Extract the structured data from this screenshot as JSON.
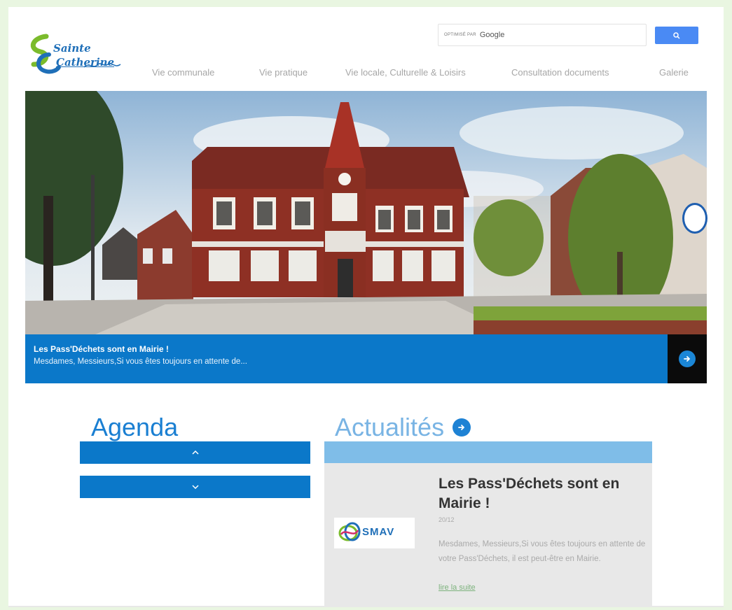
{
  "header": {
    "logo_line1": "Sainte",
    "logo_line2": "Catherine",
    "search": {
      "powered_by": "OPTIMISÉ PAR",
      "brand": "Google",
      "placeholder": ""
    }
  },
  "nav": {
    "items": [
      {
        "label": "Vie communale"
      },
      {
        "label": "Vie pratique"
      },
      {
        "label": "Vie locale, Culturelle & Loisirs"
      },
      {
        "label": "Consultation documents"
      },
      {
        "label": "Galerie"
      }
    ]
  },
  "hero": {
    "caption_title": "Les Pass'Déchets sont en Mairie !",
    "caption_text": "Mesdames, Messieurs,Si vous êtes toujours en attente de..."
  },
  "agenda": {
    "title": "Agenda",
    "up_label": "^",
    "down_label": "⌄"
  },
  "news": {
    "title": "Actualités",
    "item": {
      "title": "Les Pass'Déchets sont en Mairie !",
      "date": "20/12",
      "text": "Mesdames, Messieurs,Si vous êtes toujours en attente de votre Pass'Déchets, il est peut-être en Mairie.",
      "more": "lire la suite",
      "logo_text": "SMAV"
    }
  },
  "colors": {
    "primary": "#0b78c9",
    "news_band": "#7fbde8",
    "agenda_title": "#1a7fd2",
    "page_bg": "#e9f6e1"
  }
}
